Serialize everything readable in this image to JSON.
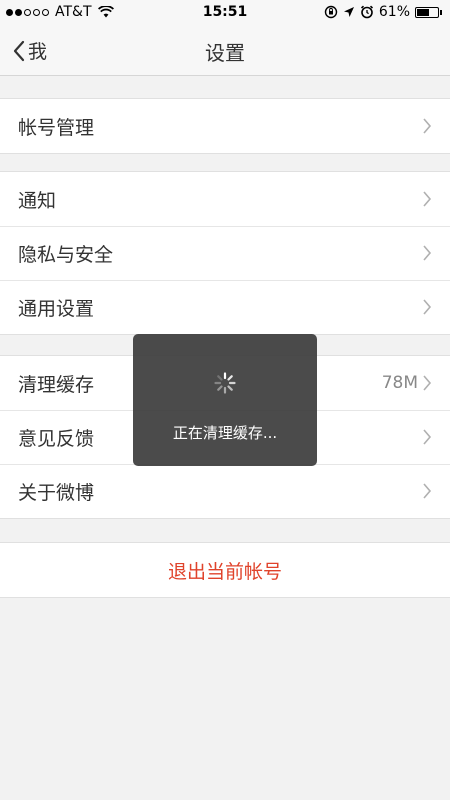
{
  "status_bar": {
    "carrier": "AT&T",
    "time": "15:51",
    "battery": "61%",
    "battery_level": 0.61
  },
  "nav": {
    "back_label": "我",
    "title": "设置"
  },
  "groups": [
    {
      "items": [
        {
          "label": "帐号管理"
        }
      ]
    },
    {
      "items": [
        {
          "label": "通知"
        },
        {
          "label": "隐私与安全"
        },
        {
          "label": "通用设置"
        }
      ]
    },
    {
      "items": [
        {
          "label": "清理缓存",
          "value": "78M"
        },
        {
          "label": "意见反馈"
        },
        {
          "label": "关于微博"
        }
      ]
    }
  ],
  "logout": {
    "label": "退出当前帐号",
    "color": "#e0432b"
  },
  "toast": {
    "message": "正在清理缓存..."
  }
}
